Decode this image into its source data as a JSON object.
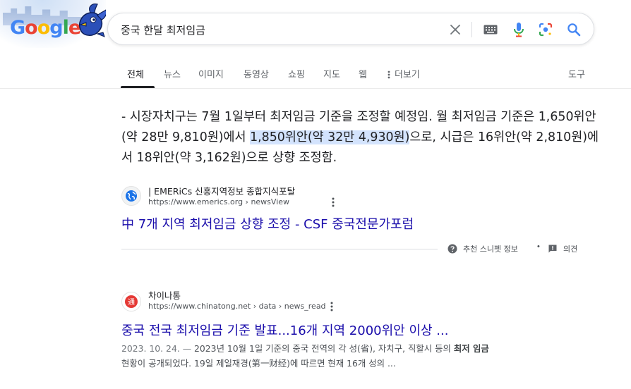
{
  "search": {
    "query": "중국 한달 최저임금"
  },
  "doodle": {
    "logo_letters": [
      "G",
      "o",
      "o",
      "g",
      "l",
      "e"
    ]
  },
  "tabs": [
    {
      "label": "전체",
      "active": true
    },
    {
      "label": "뉴스"
    },
    {
      "label": "이미지"
    },
    {
      "label": "동영상"
    },
    {
      "label": "쇼핑"
    },
    {
      "label": "지도"
    },
    {
      "label": "웹"
    },
    {
      "label": "더보기"
    }
  ],
  "tools_label": "도구",
  "featured_snippet": {
    "text_before": "- 시장자치구는 7월 1일부터 최저임금 기준을 조정할 예정임. 월 최저임금 기준은 1,650위안(약 28만 9,810원)에서 ",
    "highlight": "1,850위안(약 32만 4,930원)",
    "text_after": "으로, 시급은 16위안(약 2,810원)에서 18위안(약 3,162원)으로 상향 조정함.",
    "source_name": "| EMERiCs 신흥지역정보 종합지식포탈",
    "source_url": "https://www.emerics.org › newsView",
    "title": "中 7개 지역 최저임금 상향 조정 - CSF 중국전문가포럼",
    "about_label": "추천 스니펫 정보",
    "separator": "•",
    "feedback_label": "의견"
  },
  "result2": {
    "source_name": "차이나통",
    "source_url": "https://www.chinatong.net › data › news_read",
    "title": "중국 전국 최저임금 기준 발표...16개 지역 2000위안 이상 ...",
    "date": "2023. 10. 24. — ",
    "snippet_a": "2023년 10월 1일 기준의 중국 전역의 각 성(省), 자치구, 직할시 등의 ",
    "snippet_bold": "최저 임금",
    "snippet_b": "현황이 공개되었다. 19일 제일재경(第一财经)에 따르면 현재 16개 성의 ..."
  },
  "colors": {
    "link": "#1a0dab",
    "highlight": "#d3e3fd",
    "accent_blue": "#4285f4",
    "accent_red": "#ea4335",
    "accent_yellow": "#fbbc05",
    "accent_green": "#34a853"
  },
  "icons": [
    "clear-icon",
    "keyboard-icon",
    "mic-icon",
    "lens-icon",
    "search-icon",
    "globe-icon",
    "more-vert-icon",
    "help-icon",
    "feedback-icon"
  ]
}
